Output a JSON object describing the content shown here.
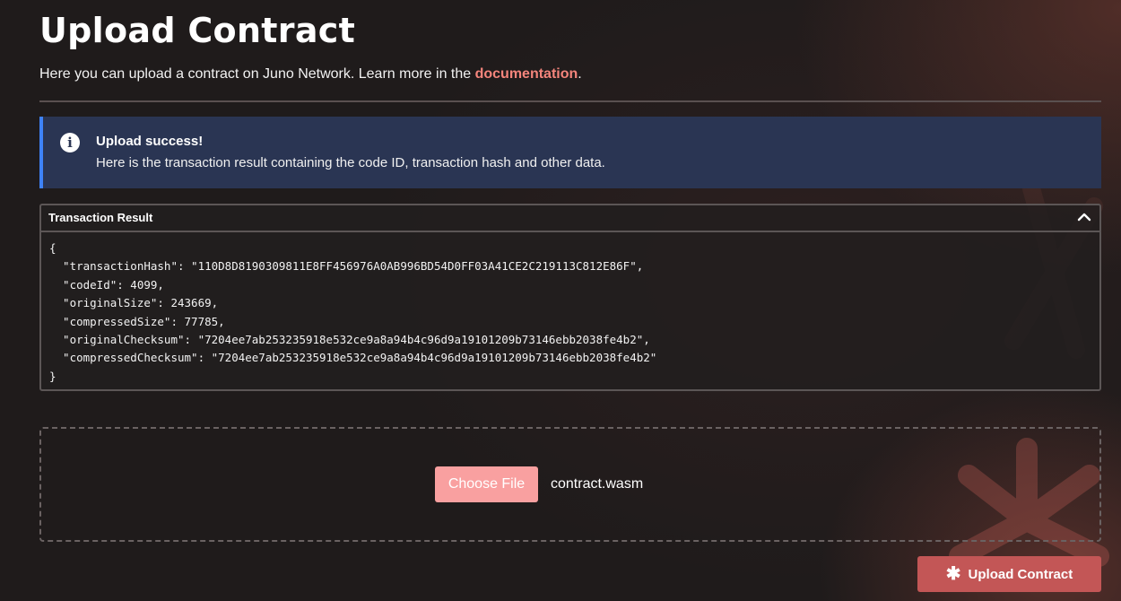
{
  "page": {
    "title": "Upload Contract",
    "subtitle_prefix": "Here you can upload a contract on Juno Network. Learn more in the ",
    "subtitle_link": "documentation",
    "subtitle_suffix": "."
  },
  "alert": {
    "icon": "info-icon",
    "title": "Upload success!",
    "body": "Here is the transaction result containing the code ID, transaction hash and other data."
  },
  "result": {
    "title": "Transaction Result",
    "collapse_icon": "chevron-up-icon",
    "json_text": "{\n  \"transactionHash\": \"110D8D8190309811E8FF456976A0AB996BD54D0FF03A41CE2C219113C812E86F\",\n  \"codeId\": 4099,\n  \"originalSize\": 243669,\n  \"compressedSize\": 77785,\n  \"originalChecksum\": \"7204ee7ab253235918e532ce9a8a94b4c96d9a19101209b73146ebb2038fe4b2\",\n  \"compressedChecksum\": \"7204ee7ab253235918e532ce9a8a94b4c96d9a19101209b73146ebb2038fe4b2\"\n}"
  },
  "upload": {
    "choose_file_label": "Choose File",
    "file_name": "contract.wasm",
    "submit_label": "Upload Contract",
    "submit_icon": "asterisk-icon"
  },
  "colors": {
    "accent": "#f4857c",
    "alert_bg": "#2a3553",
    "alert_border": "#3e82f7",
    "choose_file_bg": "#f9a0a0",
    "submit_bg": "#c35656"
  }
}
